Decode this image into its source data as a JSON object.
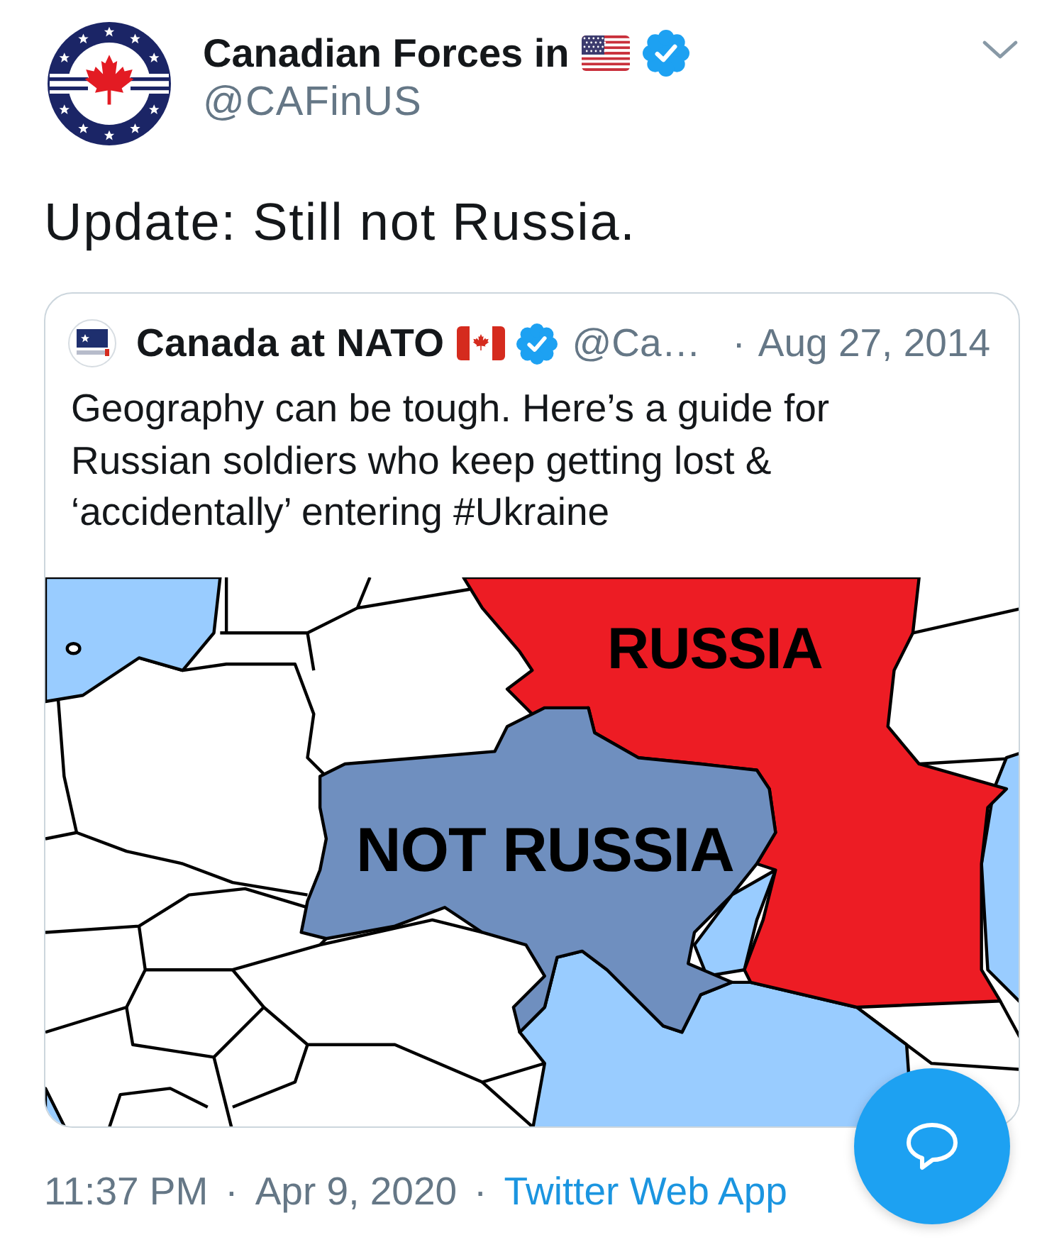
{
  "tweet": {
    "author": {
      "name": "Canadian Forces in",
      "handle": "@CAFinUS",
      "verified": true
    },
    "text": "Update: Still not Russia.",
    "quoted_tweet": {
      "author": {
        "name": "Canada at NATO",
        "handle": "@Ca…",
        "verified": true
      },
      "separator": "·",
      "date": "Aug 27, 2014",
      "text": "Geography can be tough. Here’s a guide for Russian soldiers who keep getting lost & ‘accidentally’ entering #Ukraine",
      "image": {
        "labels": [
          {
            "text": "RUSSIA"
          },
          {
            "text": "NOT RUSSIA"
          }
        ]
      }
    },
    "meta": [
      {
        "kind": "text",
        "text": "11:37 PM"
      },
      {
        "kind": "separator",
        "text": "·"
      },
      {
        "kind": "text",
        "text": "Apr 9, 2020"
      },
      {
        "kind": "separator",
        "text": "·"
      },
      {
        "kind": "link",
        "text": "Twitter Web App"
      }
    ]
  }
}
